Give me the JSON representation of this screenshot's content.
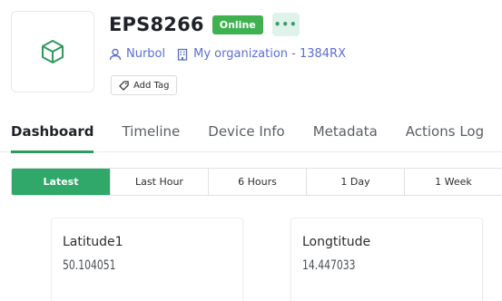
{
  "device": {
    "name": "EPS8266",
    "status": "Online",
    "more_label": "•••",
    "owner": "Nurbol",
    "organization": "My organization - 1384RX",
    "add_tag_label": "Add Tag",
    "icon": "cube-icon"
  },
  "tabs": [
    {
      "label": "Dashboard",
      "active": true
    },
    {
      "label": "Timeline",
      "active": false
    },
    {
      "label": "Device Info",
      "active": false
    },
    {
      "label": "Metadata",
      "active": false
    },
    {
      "label": "Actions Log",
      "active": false
    }
  ],
  "time_ranges": [
    {
      "label": "Latest",
      "active": true
    },
    {
      "label": "Last Hour",
      "active": false
    },
    {
      "label": "6 Hours",
      "active": false
    },
    {
      "label": "1 Day",
      "active": false
    },
    {
      "label": "1 Week",
      "active": false
    }
  ],
  "widgets": [
    {
      "label": "Latitude1",
      "value": "50.104051"
    },
    {
      "label": "Longtitude",
      "value": "14.447033"
    }
  ],
  "colors": {
    "accent": "#2fa86a",
    "status_online": "#3fb24f",
    "link": "#5b6fd6"
  }
}
